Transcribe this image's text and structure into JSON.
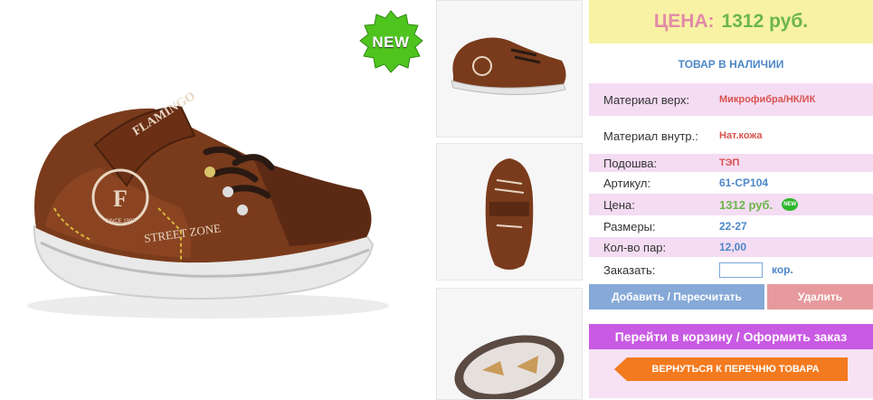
{
  "badge": {
    "new_label": "NEW"
  },
  "shoe": {
    "brand_text": "FLAMINGO",
    "logo_letter": "F",
    "since_text": "SINCE 1997",
    "street_text": "STREET ZONE"
  },
  "price_banner": {
    "label": "ЦЕНА:",
    "value": "1312 руб."
  },
  "stock_status": "ТОВАР В НАЛИЧИИ",
  "specs": [
    {
      "key": "Материал верх:",
      "value": "Микрофибра/НК/ИК"
    },
    {
      "key": "Материал внутр.:",
      "value": "Нат.кожа"
    },
    {
      "key": "Подошва:",
      "value": "ТЭП"
    },
    {
      "key": "Артикул:",
      "value": "61-CP104"
    },
    {
      "key": "Цена:",
      "value": "1312 руб.",
      "badge": "NEW"
    },
    {
      "key": "Размеры:",
      "value": "22-27"
    },
    {
      "key": "Кол-во пар:",
      "value": "12,00"
    }
  ],
  "order": {
    "label": "Заказать:",
    "value": "",
    "unit": "кор."
  },
  "buttons": {
    "update": "Добавить / Пересчитать",
    "delete": "Удалить",
    "cart": "Перейти в корзину / Оформить заказ",
    "back": "ВЕРНУТЬСЯ К ПЕРЕЧНЮ ТОВАРА"
  },
  "colors": {
    "price_banner_bg": "#f8f2a4",
    "accent_purple": "#c95ae3",
    "back_orange": "#f47a1f",
    "price_green": "#6bb64a",
    "link_blue": "#4e87c8"
  }
}
